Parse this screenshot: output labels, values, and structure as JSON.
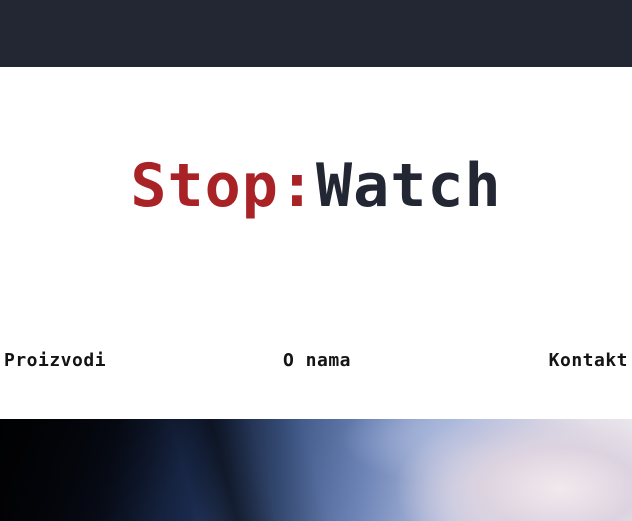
{
  "header": {
    "background_color": "#232733"
  },
  "logo": {
    "part_a": "Stop:",
    "part_b": "Watch",
    "color_a": "#a82226",
    "color_b": "#232733"
  },
  "nav": {
    "items": [
      {
        "label": "Proizvodi"
      },
      {
        "label": "O nama"
      },
      {
        "label": "Kontakt"
      }
    ]
  },
  "hero": {
    "image": "blurred-watch-photo"
  }
}
